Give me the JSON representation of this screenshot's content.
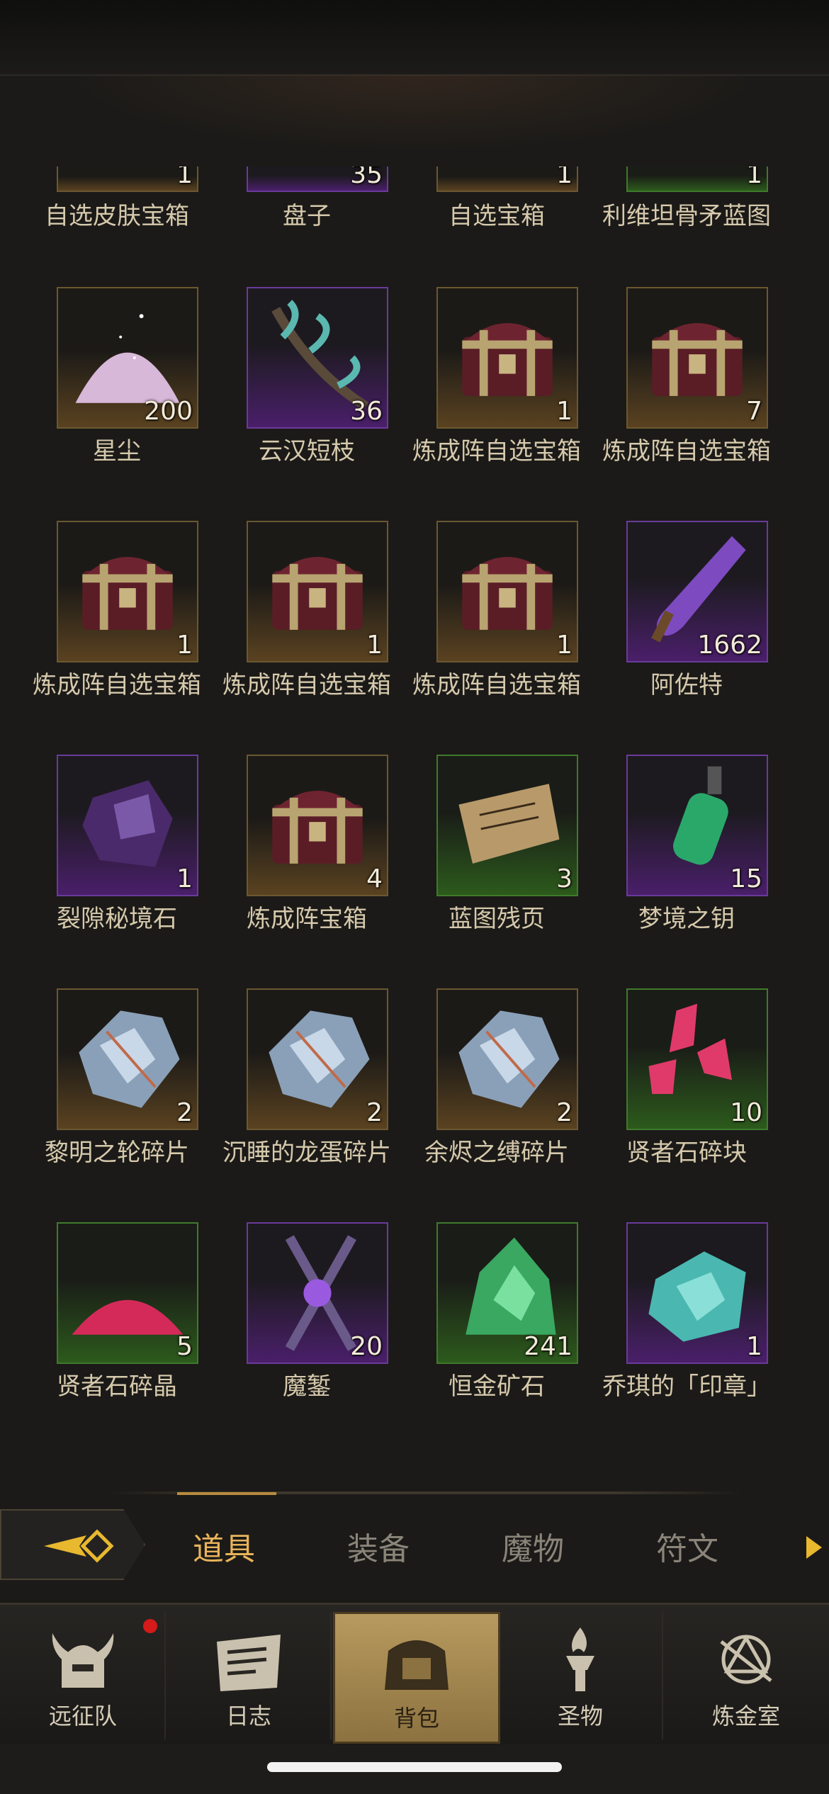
{
  "rows": [
    [
      {
        "name": "自选皮肤宝箱",
        "count": "1",
        "rarity": "gold",
        "icon": "chest-icon"
      },
      {
        "name": "盘子",
        "count": "35",
        "rarity": "purple",
        "icon": "plate-icon"
      },
      {
        "name": "自选宝箱",
        "count": "1",
        "rarity": "gold",
        "icon": "chest-icon"
      },
      {
        "name": "利维坦骨矛蓝图",
        "count": "1",
        "rarity": "green",
        "icon": "blueprint-icon"
      }
    ],
    [
      {
        "name": "星尘",
        "count": "200",
        "rarity": "gold",
        "icon": "stardust-icon"
      },
      {
        "name": "云汉短枝",
        "count": "36",
        "rarity": "purple",
        "icon": "branch-icon"
      },
      {
        "name": "炼成阵自选宝箱",
        "count": "1",
        "rarity": "gold",
        "icon": "chest-icon"
      },
      {
        "name": "炼成阵自选宝箱",
        "count": "7",
        "rarity": "gold",
        "icon": "chest-icon"
      }
    ],
    [
      {
        "name": "炼成阵自选宝箱",
        "count": "1",
        "rarity": "gold",
        "icon": "chest-icon"
      },
      {
        "name": "炼成阵自选宝箱",
        "count": "1",
        "rarity": "gold",
        "icon": "chest-icon"
      },
      {
        "name": "炼成阵自选宝箱",
        "count": "1",
        "rarity": "gold",
        "icon": "chest-icon"
      },
      {
        "name": "阿佐特",
        "count": "1662",
        "rarity": "purple",
        "icon": "vial-icon"
      }
    ],
    [
      {
        "name": "裂隙秘境石",
        "count": "1",
        "rarity": "purple",
        "icon": "rift-stone-icon"
      },
      {
        "name": "炼成阵宝箱",
        "count": "4",
        "rarity": "gold",
        "icon": "chest-icon"
      },
      {
        "name": "蓝图残页",
        "count": "3",
        "rarity": "green",
        "icon": "scroll-icon"
      },
      {
        "name": "梦境之钥",
        "count": "15",
        "rarity": "purple",
        "icon": "lantern-icon"
      }
    ],
    [
      {
        "name": "黎明之轮碎片",
        "count": "2",
        "rarity": "gold",
        "icon": "shard-icon"
      },
      {
        "name": "沉睡的龙蛋碎片",
        "count": "2",
        "rarity": "gold",
        "icon": "shard-icon"
      },
      {
        "name": "余烬之缚碎片",
        "count": "2",
        "rarity": "gold",
        "icon": "shard-icon"
      },
      {
        "name": "贤者石碎块",
        "count": "10",
        "rarity": "green",
        "icon": "crystal-icon"
      }
    ],
    [
      {
        "name": "贤者石碎晶",
        "count": "5",
        "rarity": "green",
        "icon": "crystal-pile-icon"
      },
      {
        "name": "魔錾",
        "count": "20",
        "rarity": "purple",
        "icon": "chisel-icon"
      },
      {
        "name": "恒金矿石",
        "count": "241",
        "rarity": "green",
        "icon": "ore-icon"
      },
      {
        "name": "乔琪的「印章」",
        "count": "1",
        "rarity": "purple",
        "icon": "seal-icon"
      }
    ]
  ],
  "tabs": {
    "items": [
      "道具",
      "装备",
      "魔物",
      "符文"
    ],
    "active": "道具"
  },
  "nav": {
    "items": [
      {
        "label": "远征队",
        "icon": "helmet-icon"
      },
      {
        "label": "日志",
        "icon": "journal-icon"
      },
      {
        "label": "背包",
        "icon": "backpack-icon"
      },
      {
        "label": "圣物",
        "icon": "torch-icon"
      },
      {
        "label": "炼金室",
        "icon": "alchemy-icon"
      }
    ],
    "active": "背包"
  },
  "colors": {
    "gold": "#6b5730",
    "purple": "#6a3a9a",
    "green": "#3f7a2c",
    "tab_active": "#e8b35a",
    "notification": "#d41a1a"
  }
}
